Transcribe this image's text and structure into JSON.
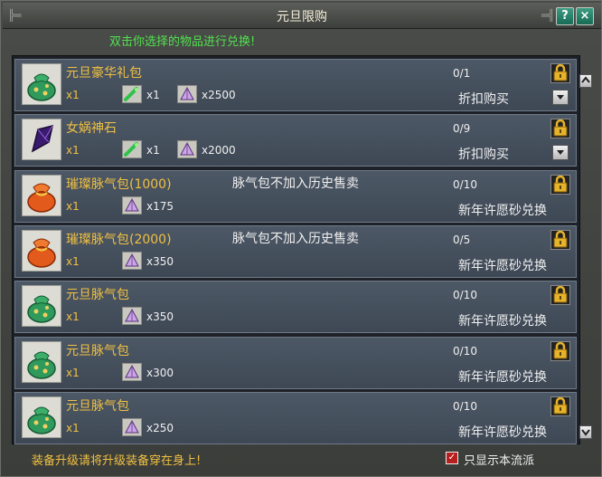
{
  "window": {
    "title": "元旦限购",
    "help_label": "?",
    "close_label": "×"
  },
  "instruction": "双击你选择的物品进行兑换!",
  "items": [
    {
      "name": "元旦豪华礼包",
      "qty": "x1",
      "costs": [
        {
          "icon": "jade-stick-icon",
          "count": "x1"
        },
        {
          "icon": "crystal-sand-icon",
          "count": "x2500"
        }
      ],
      "note": "",
      "progress": "0/1",
      "action": "折扣购买",
      "icon": "green-bag-icon",
      "dropdown": true
    },
    {
      "name": "女娲神石",
      "qty": "x1",
      "costs": [
        {
          "icon": "jade-stick-icon",
          "count": "x1"
        },
        {
          "icon": "crystal-sand-icon",
          "count": "x2000"
        }
      ],
      "note": "",
      "progress": "0/9",
      "action": "折扣购买",
      "icon": "purple-stone-icon",
      "dropdown": true
    },
    {
      "name": "璀璨脉气包(1000)",
      "qty": "x1",
      "costs": [
        {
          "icon": "crystal-sand-icon",
          "count": "x175"
        }
      ],
      "note": "脉气包不加入历史售卖",
      "progress": "0/10",
      "action": "新年许愿砂兑换",
      "icon": "red-bag-icon",
      "dropdown": false
    },
    {
      "name": "璀璨脉气包(2000)",
      "qty": "x1",
      "costs": [
        {
          "icon": "crystal-sand-icon",
          "count": "x350"
        }
      ],
      "note": "脉气包不加入历史售卖",
      "progress": "0/5",
      "action": "新年许愿砂兑换",
      "icon": "red-bag-icon",
      "dropdown": false
    },
    {
      "name": "元旦脉气包",
      "qty": "x1",
      "costs": [
        {
          "icon": "crystal-sand-icon",
          "count": "x350"
        }
      ],
      "note": "",
      "progress": "0/10",
      "action": "新年许愿砂兑换",
      "icon": "green-bag-icon",
      "dropdown": false
    },
    {
      "name": "元旦脉气包",
      "qty": "x1",
      "costs": [
        {
          "icon": "crystal-sand-icon",
          "count": "x300"
        }
      ],
      "note": "",
      "progress": "0/10",
      "action": "新年许愿砂兑换",
      "icon": "green-bag-icon",
      "dropdown": false
    },
    {
      "name": "元旦脉气包",
      "qty": "x1",
      "costs": [
        {
          "icon": "crystal-sand-icon",
          "count": "x250"
        }
      ],
      "note": "",
      "progress": "0/10",
      "action": "新年许愿砂兑换",
      "icon": "green-bag-icon",
      "dropdown": false
    }
  ],
  "footer": {
    "hint": "装备升级请将升级装备穿在身上!",
    "checkbox_label": "只显示本流派",
    "checkbox_checked": true
  },
  "colors": {
    "title_text": "#f4efd8",
    "instruction": "#52e04f",
    "item_name": "#f0c042",
    "hint": "#f0c042",
    "row_bg": "#4d5866"
  }
}
